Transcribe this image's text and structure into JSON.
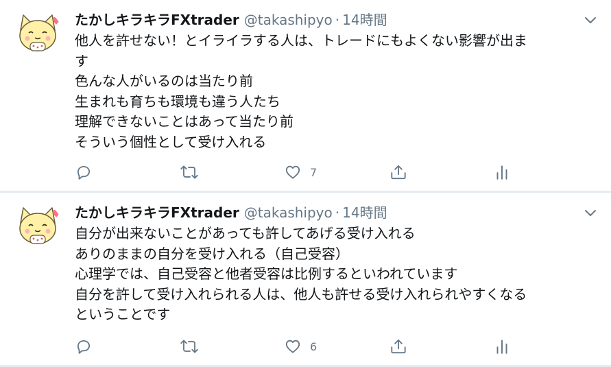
{
  "tweets": [
    {
      "author": {
        "display_name": "たかしキラキラFXtrader",
        "handle": "@takashipyo",
        "separator": "·",
        "time": "14時間",
        "avatar_icon": "cat-avatar-icon"
      },
      "lines": [
        "他人を許せない！とイライラする人は、トレードにもよくない影響が出ま",
        "す",
        "色んな人がいるのは当たり前",
        "生まれも育ちも環境も違う人たち",
        "理解できないことはあって当たり前",
        "そういう個性として受け入れる"
      ],
      "actions": {
        "reply_count": "",
        "retweet_count": "",
        "like_count": "7"
      }
    },
    {
      "author": {
        "display_name": "たかしキラキラFXtrader",
        "handle": "@takashipyo",
        "separator": "·",
        "time": "14時間",
        "avatar_icon": "cat-avatar-icon"
      },
      "lines": [
        "自分が出来ないことがあっても許してあげる受け入れる",
        "ありのままの自分を受け入れる（自己受容）",
        "心理学では、自己受容と他者受容は比例するといわれています",
        "自分を許して受け入れられる人は、他人も許せる受け入れられやすくなる",
        "ということです"
      ],
      "actions": {
        "reply_count": "",
        "retweet_count": "",
        "like_count": "6"
      }
    }
  ],
  "colors": {
    "text_primary": "#14171a",
    "text_secondary": "#657786",
    "divider": "#e6ecf0",
    "avatar_cat": "#fff2a8",
    "avatar_heart": "#ff6f8a"
  },
  "icons": {
    "reply": "reply-icon",
    "retweet": "retweet-icon",
    "like": "heart-icon",
    "share": "share-icon",
    "analytics": "analytics-icon",
    "menu": "chevron-down-icon"
  }
}
